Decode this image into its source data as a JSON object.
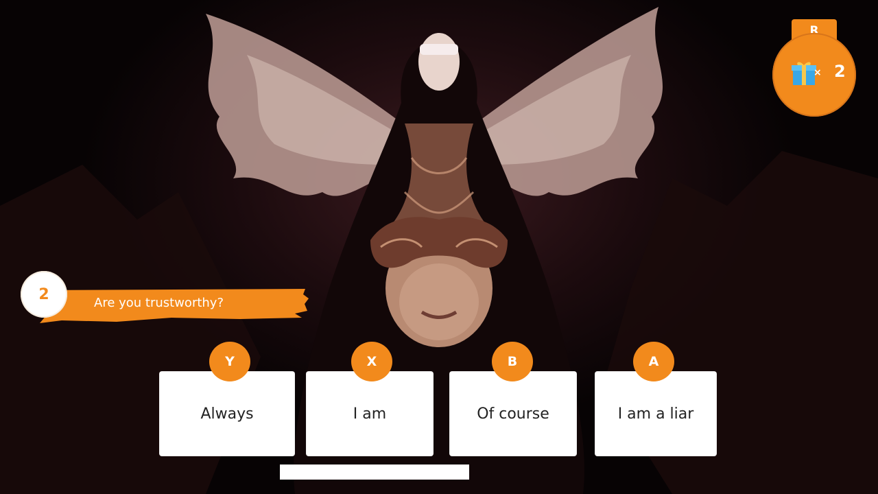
{
  "hud": {
    "gift_counter": {
      "button_hint": "R",
      "icon": "gift-icon",
      "multiplier": "×",
      "count": "2"
    }
  },
  "question": {
    "number": "2",
    "text": "Are you trustworthy?"
  },
  "answers": [
    {
      "button": "Y",
      "label": "Always"
    },
    {
      "button": "X",
      "label": "I am"
    },
    {
      "button": "B",
      "label": "Of course"
    },
    {
      "button": "A",
      "label": "I am a liar"
    }
  ],
  "colors": {
    "accent": "#f28a1c",
    "card": "#ffffff",
    "background": "#1c0b0e"
  }
}
